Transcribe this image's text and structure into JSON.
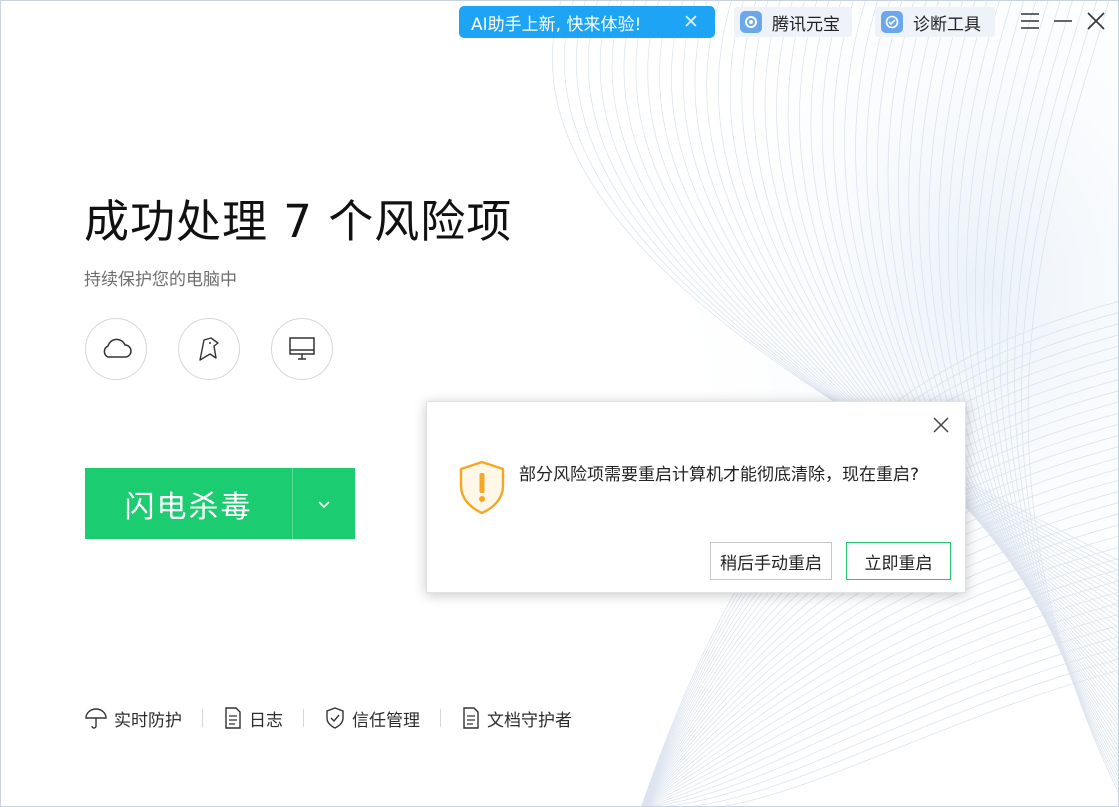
{
  "topbar": {
    "ai_banner": "AI助手上新, 快来体验!",
    "yuanbao_label": "腾讯元宝",
    "diagnose_label": "诊断工具"
  },
  "main": {
    "title": "成功处理 7 个风险项",
    "subtitle": "持续保护您的电脑中",
    "scan_button": "闪电杀毒"
  },
  "bottom_nav": [
    {
      "label": "实时防护",
      "icon": "umbrella-icon"
    },
    {
      "label": "日志",
      "icon": "document-icon"
    },
    {
      "label": "信任管理",
      "icon": "shield-check-icon"
    },
    {
      "label": "文档守护者",
      "icon": "document-icon"
    }
  ],
  "dialog": {
    "message": "部分风险项需要重启计算机才能彻底清除，现在重启?",
    "later_button": "稍后手动重启",
    "now_button": "立即重启"
  },
  "colors": {
    "accent_green": "#1ccc70",
    "ai_blue": "#1ea4f5",
    "warning_orange": "#f5a623"
  }
}
